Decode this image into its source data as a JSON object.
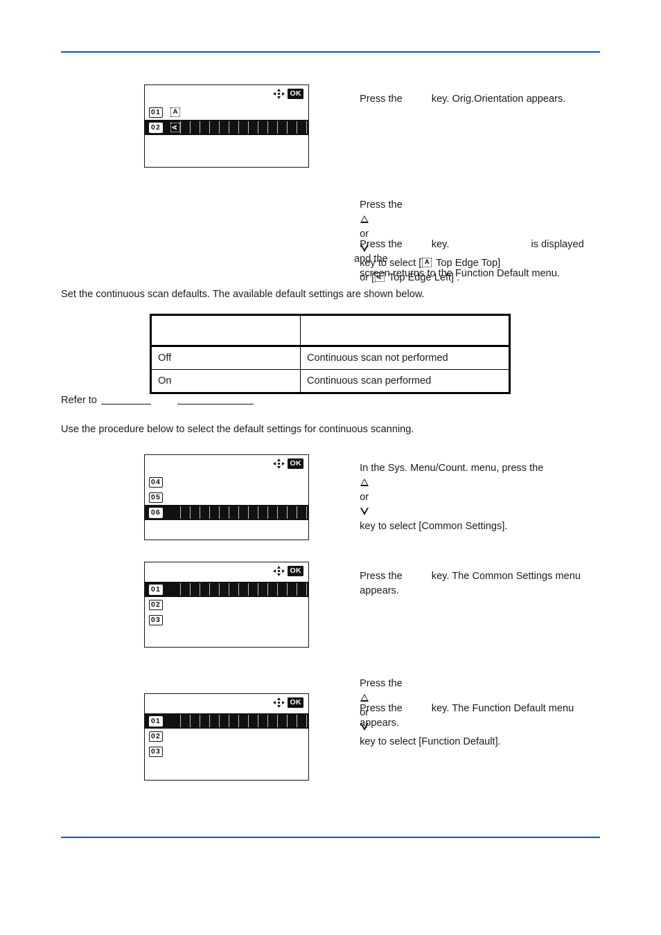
{
  "page": {
    "rule_color": "#0b57b8",
    "background": "#ffffff"
  },
  "steps": {
    "orientation": {
      "line1_pre": "Press the",
      "line1_post": "key. Orig.Orientation appears.",
      "select_pre": "Press the",
      "select_mid": "or",
      "select_post": "key to select [",
      "option1": " Top Edge Top]",
      "option2_pre": "or [",
      "option2": " Top Edge Left] .",
      "confirm_pre": "Press the",
      "confirm_mid": "key.",
      "confirm_post": "is displayed and the",
      "confirm_line2": "screen returns to the Function Default menu."
    },
    "common_settings": {
      "line1": "In the Sys. Menu/Count. menu, press the",
      "line1_mid": "or",
      "line2": "key to select [Common Settings].",
      "press_pre": "Press the",
      "press_mid": "key. The Common Settings menu",
      "press_line2": "appears."
    },
    "function_default": {
      "select_pre": "Press the",
      "select_mid": "or",
      "select_post": "key to select [Function Default].",
      "press_pre": "Press the",
      "press_mid": "key. The Function Default menu",
      "press_line2": "appears."
    }
  },
  "body": {
    "intro": "Set the continuous scan defaults. The available default settings are shown below.",
    "refer_label": "Refer to",
    "procedure": "Use the procedure below to select the default settings for continuous scanning."
  },
  "table": {
    "header": [
      "",
      ""
    ],
    "rows": [
      [
        "Off",
        "Continuous scan not performed"
      ],
      [
        "On",
        "Continuous scan performed"
      ]
    ]
  },
  "lcd_screens": [
    {
      "name": "orig-orientation-screen",
      "ok_label": "OK",
      "dpad_icon": "four-way-arrow-icon",
      "rows": [
        {
          "num": "01",
          "glyph": "top-edge-top-icon",
          "glyph_letter": "A",
          "glyph_rotated": false,
          "selected": false
        },
        {
          "num": "02",
          "glyph": "top-edge-left-icon",
          "glyph_letter": "A",
          "glyph_rotated": true,
          "selected": true
        }
      ]
    },
    {
      "name": "sys-menu-count-screen",
      "ok_label": "OK",
      "dpad_icon": "four-way-arrow-icon",
      "rows": [
        {
          "num": "04",
          "glyph": "",
          "glyph_letter": "",
          "glyph_rotated": false,
          "selected": false
        },
        {
          "num": "05",
          "glyph": "",
          "glyph_letter": "",
          "glyph_rotated": false,
          "selected": false
        },
        {
          "num": "06",
          "glyph": "",
          "glyph_letter": "",
          "glyph_rotated": false,
          "selected": true
        }
      ]
    },
    {
      "name": "common-settings-screen",
      "ok_label": "OK",
      "dpad_icon": "four-way-arrow-icon",
      "rows": [
        {
          "num": "01",
          "glyph": "",
          "glyph_letter": "",
          "glyph_rotated": false,
          "selected": true
        },
        {
          "num": "02",
          "glyph": "",
          "glyph_letter": "",
          "glyph_rotated": false,
          "selected": false
        },
        {
          "num": "03",
          "glyph": "",
          "glyph_letter": "",
          "glyph_rotated": false,
          "selected": false
        }
      ]
    },
    {
      "name": "function-default-screen",
      "ok_label": "OK",
      "dpad_icon": "four-way-arrow-icon",
      "rows": [
        {
          "num": "01",
          "glyph": "",
          "glyph_letter": "",
          "glyph_rotated": false,
          "selected": true
        },
        {
          "num": "02",
          "glyph": "",
          "glyph_letter": "",
          "glyph_rotated": false,
          "selected": false
        },
        {
          "num": "03",
          "glyph": "",
          "glyph_letter": "",
          "glyph_rotated": false,
          "selected": false
        }
      ]
    }
  ]
}
